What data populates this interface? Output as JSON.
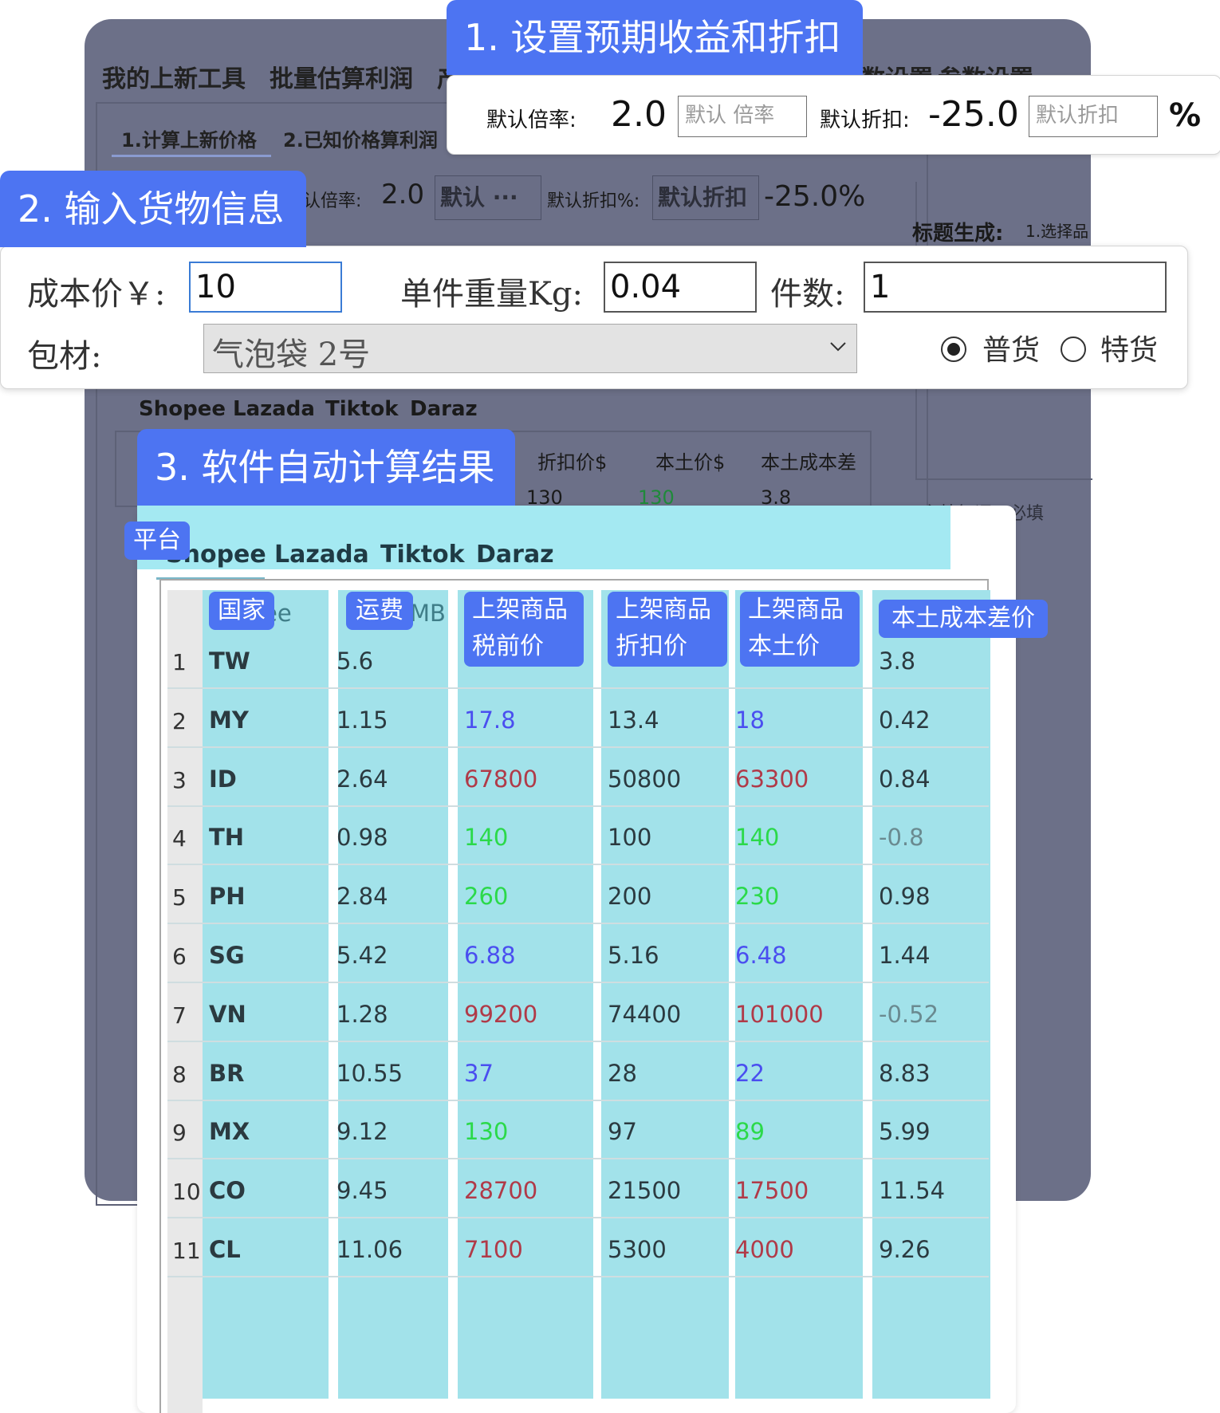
{
  "colors": {
    "badge": "#4d74f2",
    "window": "#6c7088",
    "table_cyan": "#a2e2ea",
    "blue": "#4a4ef0",
    "red": "#b03a48",
    "green": "#2bd94a",
    "dark": "#2b3a40",
    "grey": "#6a8a90"
  },
  "background_window": {
    "menu": [
      "我的上新工具",
      "批量估算利润",
      "产",
      "数设置",
      "参数设置"
    ],
    "subtabs": [
      "1.计算上新价格",
      "2.已知价格算利润"
    ],
    "rate_label": "认倍率:",
    "rate_value": "2.0",
    "rate_placeholder": "默认 ···",
    "discount_label": "默认折扣%:",
    "discount_placeholder": "默认折扣",
    "discount_value": "-25.0%",
    "title_gen": "标题生成:",
    "title_gen_hint": "1.选择品",
    "platforms": [
      "Shopee",
      "Lazada",
      "Tiktok",
      "Daraz"
    ],
    "headers": [
      "折扣价$",
      "本土价$",
      "本土成本差"
    ],
    "first_row": [
      "130",
      "130",
      "3.8"
    ],
    "keyword_text": "主特征词1 必填"
  },
  "callouts": {
    "step1": "1. 设置预期收益和折扣",
    "step2": "2. 输入货物信息",
    "step3": "3. 软件自动计算结果",
    "platform": "平台",
    "country": "国家",
    "shipping": "运费",
    "pretax": [
      "上架商品",
      "税前价"
    ],
    "discount_price": [
      "上架商品",
      "折扣价"
    ],
    "local_price": [
      "上架商品",
      "本土价"
    ],
    "cost_diff": "本土成本差价"
  },
  "settings": {
    "rate_label": "默认倍率:",
    "rate_value": "2.0",
    "rate_placeholder": "默认 倍率",
    "discount_label": "默认折扣:",
    "discount_value": "-25.0",
    "discount_placeholder": "默认折扣",
    "percent": "%"
  },
  "goods": {
    "cost_label": "成本价￥:",
    "cost_value": "10",
    "weight_label": "单件重量Kg:",
    "weight_value": "0.04",
    "qty_label": "件数:",
    "qty_value": "1",
    "packaging_label": "包材:",
    "packaging_value": "气泡袋 2号",
    "chevron": "chevron-down-icon",
    "radio_normal": "普货",
    "radio_special": "特货",
    "selected_radio": "普货"
  },
  "results": {
    "platform_tabs": [
      "Shopee",
      "Lazada",
      "Tiktok",
      "Daraz"
    ],
    "header_ghosts": [
      "ee",
      "MB"
    ],
    "rows": [
      {
        "n": "1",
        "country": "TW",
        "ship": "5.6",
        "pretax": "",
        "disc": "",
        "local": "",
        "diff": "3.8",
        "pc": "blue",
        "dc": "dark"
      },
      {
        "n": "2",
        "country": "MY",
        "ship": "1.15",
        "pretax": "17.8",
        "disc": "13.4",
        "local": "18",
        "diff": "0.42",
        "pc": "blue",
        "dc": "dark"
      },
      {
        "n": "3",
        "country": "ID",
        "ship": "2.64",
        "pretax": "67800",
        "disc": "50800",
        "local": "63300",
        "diff": "0.84",
        "pc": "red",
        "dc": "dark"
      },
      {
        "n": "4",
        "country": "TH",
        "ship": "0.98",
        "pretax": "140",
        "disc": "100",
        "local": "140",
        "diff": "-0.8",
        "pc": "green",
        "dc": "grey"
      },
      {
        "n": "5",
        "country": "PH",
        "ship": "2.84",
        "pretax": "260",
        "disc": "200",
        "local": "230",
        "diff": "0.98",
        "pc": "green",
        "dc": "dark"
      },
      {
        "n": "6",
        "country": "SG",
        "ship": "5.42",
        "pretax": "6.88",
        "disc": "5.16",
        "local": "6.48",
        "diff": "1.44",
        "pc": "blue",
        "dc": "dark"
      },
      {
        "n": "7",
        "country": "VN",
        "ship": "1.28",
        "pretax": "99200",
        "disc": "74400",
        "local": "101000",
        "diff": "-0.52",
        "pc": "red",
        "dc": "grey"
      },
      {
        "n": "8",
        "country": "BR",
        "ship": "10.55",
        "pretax": "37",
        "disc": "28",
        "local": "22",
        "diff": "8.83",
        "pc": "blue",
        "dc": "dark"
      },
      {
        "n": "9",
        "country": "MX",
        "ship": "9.12",
        "pretax": "130",
        "disc": "97",
        "local": "89",
        "diff": "5.99",
        "pc": "green",
        "dc": "dark"
      },
      {
        "n": "10",
        "country": "CO",
        "ship": "9.45",
        "pretax": "28700",
        "disc": "21500",
        "local": "17500",
        "diff": "11.54",
        "pc": "red",
        "dc": "dark"
      },
      {
        "n": "11",
        "country": "CL",
        "ship": "11.06",
        "pretax": "7100",
        "disc": "5300",
        "local": "4000",
        "diff": "9.26",
        "pc": "red",
        "dc": "dark"
      }
    ]
  }
}
